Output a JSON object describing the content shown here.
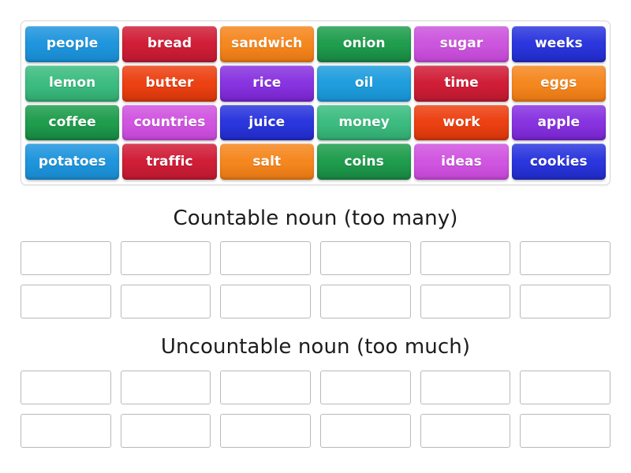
{
  "activity": {
    "type": "group-sort",
    "tile_rows": 4,
    "tile_columns": 6,
    "slot_rows_per_group": 2,
    "slot_columns": 6
  },
  "tray": {
    "tiles": [
      {
        "label": "people",
        "color": "#1f95dd",
        "color_dark": "#1786c9"
      },
      {
        "label": "bread",
        "color": "#d01e37",
        "color_dark": "#b5182e"
      },
      {
        "label": "sandwich",
        "color": "#f5871f",
        "color_dark": "#e07412"
      },
      {
        "label": "onion",
        "color": "#1f9d4d",
        "color_dark": "#17813f"
      },
      {
        "label": "sugar",
        "color": "#cc55dd",
        "color_dark": "#bb43ce"
      },
      {
        "label": "weeks",
        "color": "#2b36dd",
        "color_dark": "#1f29bf"
      },
      {
        "label": "lemon",
        "color": "#3cbc80",
        "color_dark": "#2fa46c"
      },
      {
        "label": "butter",
        "color": "#ec4112",
        "color_dark": "#cf340a"
      },
      {
        "label": "rice",
        "color": "#8833e0",
        "color_dark": "#7222c6"
      },
      {
        "label": "oil",
        "color": "#1f9ddd",
        "color_dark": "#178cc9"
      },
      {
        "label": "time",
        "color": "#d01e37",
        "color_dark": "#b5182e"
      },
      {
        "label": "eggs",
        "color": "#f5871f",
        "color_dark": "#e07412"
      },
      {
        "label": "coffee",
        "color": "#1f9d4d",
        "color_dark": "#17813f"
      },
      {
        "label": "countries",
        "color": "#d055e0",
        "color_dark": "#be43cf"
      },
      {
        "label": "juice",
        "color": "#2b36dd",
        "color_dark": "#1f29bf"
      },
      {
        "label": "money",
        "color": "#3cbc80",
        "color_dark": "#2fa46c"
      },
      {
        "label": "work",
        "color": "#ec4112",
        "color_dark": "#cf340a"
      },
      {
        "label": "apple",
        "color": "#8833e0",
        "color_dark": "#7222c6"
      },
      {
        "label": "potatoes",
        "color": "#1f95dd",
        "color_dark": "#1786c9"
      },
      {
        "label": "traffic",
        "color": "#d01e37",
        "color_dark": "#b5182e"
      },
      {
        "label": "salt",
        "color": "#f5871f",
        "color_dark": "#e07412"
      },
      {
        "label": "coins",
        "color": "#1f9d4d",
        "color_dark": "#17813f"
      },
      {
        "label": "ideas",
        "color": "#d055e0",
        "color_dark": "#be43cf"
      },
      {
        "label": "cookies",
        "color": "#2b36dd",
        "color_dark": "#1f29bf"
      }
    ]
  },
  "groups": [
    {
      "title": "Countable noun (too many)",
      "slots": [
        "",
        "",
        "",
        "",
        "",
        "",
        "",
        "",
        "",
        "",
        "",
        ""
      ]
    },
    {
      "title": "Uncountable noun (too much)",
      "slots": [
        "",
        "",
        "",
        "",
        "",
        "",
        "",
        "",
        "",
        "",
        "",
        ""
      ]
    }
  ]
}
